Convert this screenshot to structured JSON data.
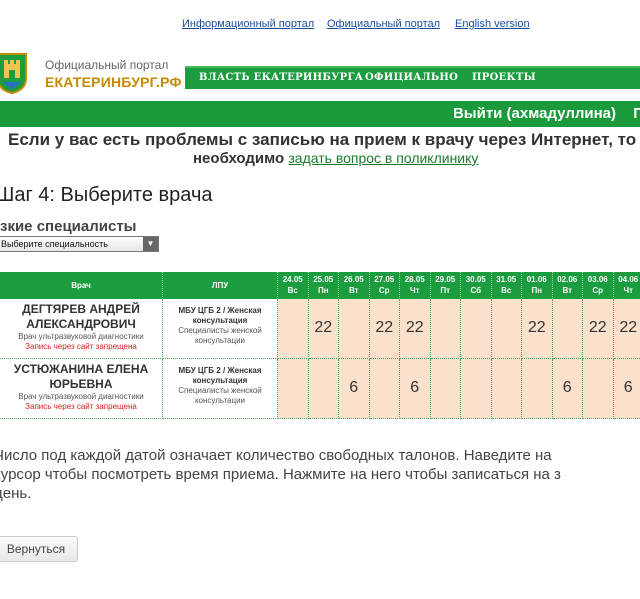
{
  "top_links": [
    "Информационный портал",
    "Официальный портал",
    "English version"
  ],
  "logo": {
    "line1": "Официальный портал",
    "line2": "ЕКАТЕРИНБУРГ.РФ"
  },
  "main_nav": [
    "ВЛАСТЬ ЕКАТЕРИНБУРГА",
    "ОФИЦИАЛЬНО",
    "ПРОЕКТЫ"
  ],
  "user_bar": {
    "logout": "Выйти (ахмадуллина)",
    "extra": "П"
  },
  "notice": {
    "line1": "Если у вас есть проблемы с записью на прием к врачу через Интернет, то",
    "line2_bold": "необходимо",
    "link": "задать вопрос в поликлинику"
  },
  "step_title": "Шаг 4: Выберите врача",
  "specialty": {
    "title": "зкие специалисты",
    "select_value": "Выберите специальность"
  },
  "table": {
    "header_doctor": "Врач",
    "header_lpu": "ЛПУ",
    "dates": [
      {
        "date": "24.05",
        "day": "Вс"
      },
      {
        "date": "25.05",
        "day": "Пн"
      },
      {
        "date": "26.05",
        "day": "Вт"
      },
      {
        "date": "27.05",
        "day": "Ср"
      },
      {
        "date": "28.05",
        "day": "Чт"
      },
      {
        "date": "29.05",
        "day": "Пт"
      },
      {
        "date": "30.05",
        "day": "Сб"
      },
      {
        "date": "31.05",
        "day": "Вс"
      },
      {
        "date": "01.06",
        "day": "Пн"
      },
      {
        "date": "02.06",
        "day": "Вт"
      },
      {
        "date": "03.06",
        "day": "Ср"
      },
      {
        "date": "04.06",
        "day": "Чт"
      }
    ],
    "rows": [
      {
        "name": "ДЕГТЯРЕВ АНДРЕЙ АЛЕКСАНДРОВИЧ",
        "role": "Врач ультразвуковой диагностики",
        "warning": "Запись через сайт запрещена",
        "lpu": "МБУ ЦГБ 2 / Женская консультация",
        "dept": "Специалисты женской консультации",
        "slots": [
          "",
          "22",
          "",
          "22",
          "22",
          "",
          "",
          "",
          "22",
          "",
          "22",
          "22"
        ]
      },
      {
        "name": "УСТЮЖАНИНА ЕЛЕНА ЮРЬЕВНА",
        "role": "Врач ультразвуковой диагностики",
        "warning": "Запись через сайт запрещена",
        "lpu": "МБУ ЦГБ 2 / Женская консультация",
        "dept": "Специалисты женской консультации",
        "slots": [
          "",
          "",
          "6",
          "",
          "6",
          "",
          "",
          "",
          "",
          "6",
          "",
          "6"
        ]
      }
    ]
  },
  "info": [
    "Число под каждой датой означает количество свободных талонов. Наведите на",
    "курсор чтобы посмотреть время приема. Нажмите на него чтобы записаться на з",
    "день."
  ],
  "back_button": "Вернуться"
}
